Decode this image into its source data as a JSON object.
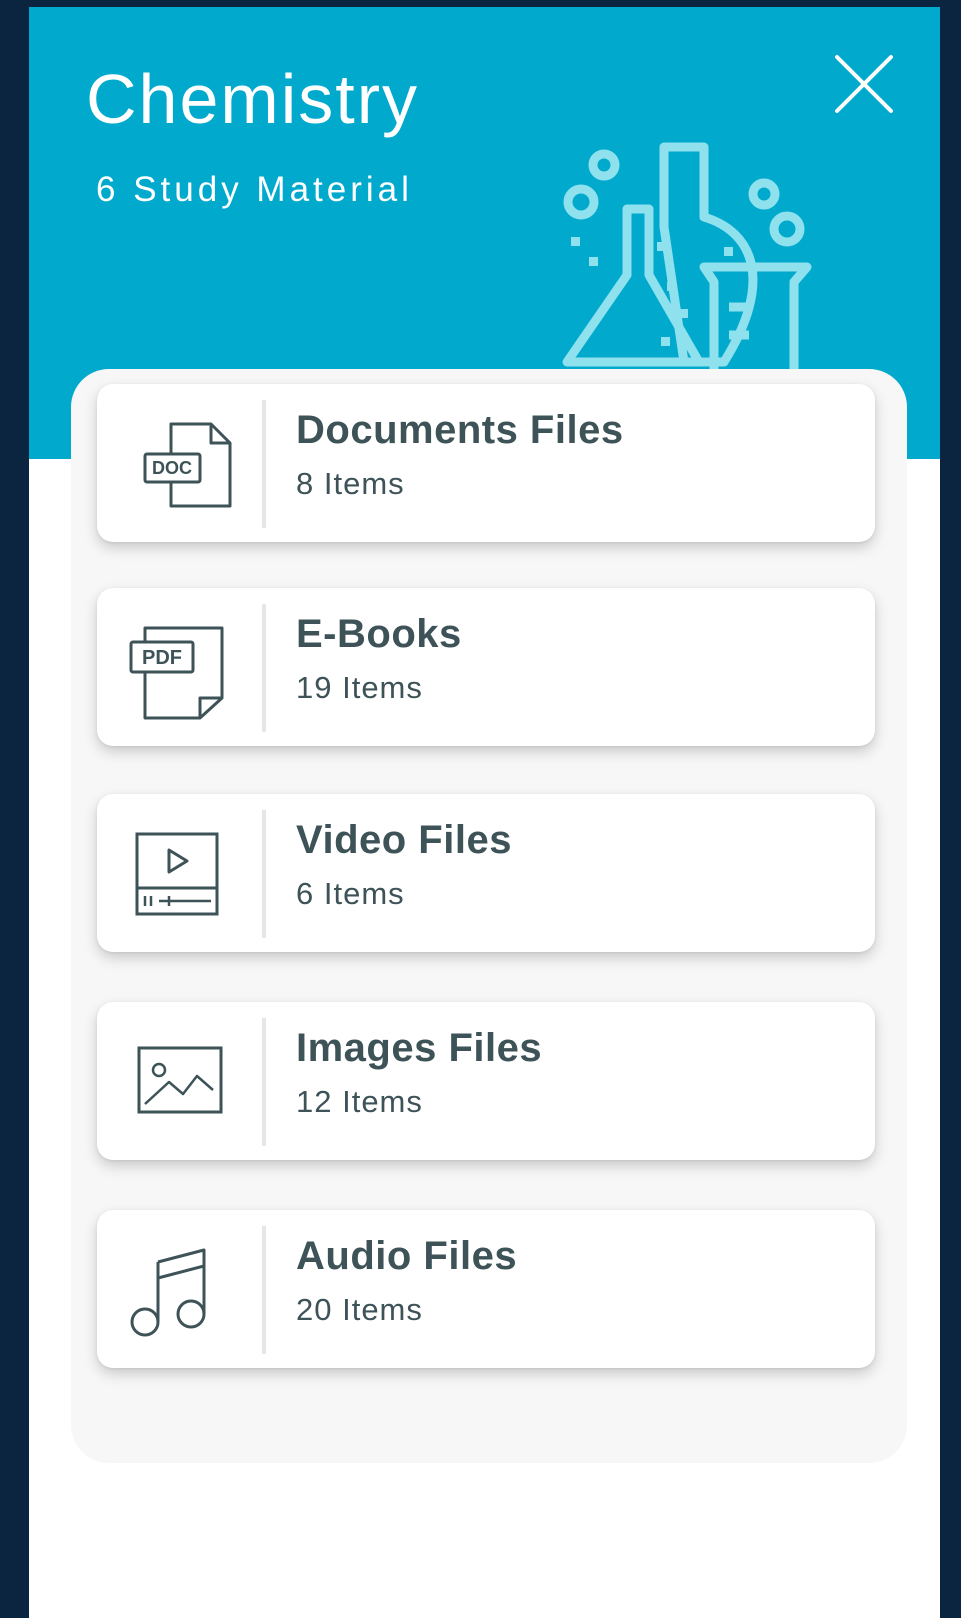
{
  "header": {
    "title": "Chemistry",
    "subtitle": "6 Study Material",
    "close_icon": "close-icon",
    "illustration": "lab-flasks-illustration",
    "background_color": "#01aacd"
  },
  "categories": [
    {
      "label": "Documents Files",
      "count": "8 Items",
      "icon": "doc-file-icon",
      "icon_text": "DOC"
    },
    {
      "label": "E-Books",
      "count": "19 Items",
      "icon": "pdf-file-icon",
      "icon_text": "PDF"
    },
    {
      "label": "Video Files",
      "count": "6 Items",
      "icon": "video-player-icon"
    },
    {
      "label": "Images Files",
      "count": "12 Items",
      "icon": "image-icon"
    },
    {
      "label": "Audio Files",
      "count": "20 Items",
      "icon": "music-note-icon"
    }
  ],
  "colors": {
    "accent": "#01aacd",
    "text": "#3e5358",
    "outer_background": "#0b2540"
  }
}
